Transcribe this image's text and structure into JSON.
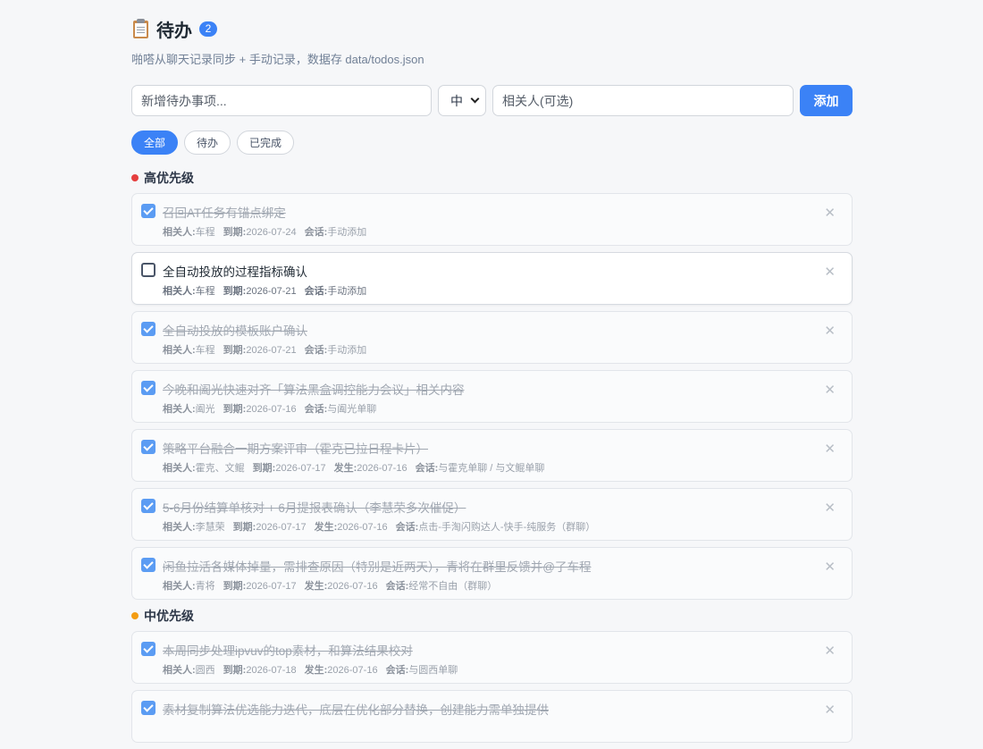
{
  "header": {
    "title": "待办",
    "count": "2",
    "subtitle": "啪嗒从聊天记录同步 + 手动记录，数据存 data/todos.json"
  },
  "add_form": {
    "task_placeholder": "新增待办事项...",
    "priority_value": "中",
    "person_placeholder": "相关人(可选)",
    "add_label": "添加"
  },
  "filters": [
    {
      "label": "全部",
      "active": true
    },
    {
      "label": "待办",
      "active": false
    },
    {
      "label": "已完成",
      "active": false
    }
  ],
  "sections": [
    {
      "title": "高优先级",
      "color": "#e53e3e",
      "items": [
        {
          "done": true,
          "title": "召回AT任务有锚点绑定",
          "meta": [
            [
              "相关人:",
              "车程"
            ],
            [
              "到期:",
              "2026-07-24"
            ],
            [
              "会话:",
              "手动添加"
            ]
          ]
        },
        {
          "done": false,
          "title": "全自动投放的过程指标确认",
          "meta": [
            [
              "相关人:",
              "车程"
            ],
            [
              "到期:",
              "2026-07-21"
            ],
            [
              "会话:",
              "手动添加"
            ]
          ]
        },
        {
          "done": true,
          "title": "全自动投放的模板账户确认",
          "meta": [
            [
              "相关人:",
              "车程"
            ],
            [
              "到期:",
              "2026-07-21"
            ],
            [
              "会话:",
              "手动添加"
            ]
          ]
        },
        {
          "done": true,
          "title": "今晚和阖光快速对齐「算法黑盒调控能力会议」相关内容",
          "meta": [
            [
              "相关人:",
              "阖光"
            ],
            [
              "到期:",
              "2026-07-16"
            ],
            [
              "会话:",
              "与阖光单聊"
            ]
          ]
        },
        {
          "done": true,
          "title": "策略平台融合一期方案评审（霍克已拉日程卡片）",
          "meta": [
            [
              "相关人:",
              "霍克、文鲲"
            ],
            [
              "到期:",
              "2026-07-17"
            ],
            [
              "发生:",
              "2026-07-16"
            ],
            [
              "会话:",
              "与霍克单聊 / 与文鲲单聊"
            ]
          ]
        },
        {
          "done": true,
          "title": "5-6月份结算单核对 + 6月提报表确认（李慧荣多次催促）",
          "meta": [
            [
              "相关人:",
              "李慧荣"
            ],
            [
              "到期:",
              "2026-07-17"
            ],
            [
              "发生:",
              "2026-07-16"
            ],
            [
              "会话:",
              "点击-手淘闪购达人-快手-纯服务（群聊）"
            ]
          ]
        },
        {
          "done": true,
          "title": "闲鱼拉活各媒体掉量，需排查原因（特别是近两天），青将在群里反馈并@了车程",
          "meta": [
            [
              "相关人:",
              "青将"
            ],
            [
              "到期:",
              "2026-07-17"
            ],
            [
              "发生:",
              "2026-07-16"
            ],
            [
              "会话:",
              "经常不自由（群聊）"
            ]
          ]
        }
      ]
    },
    {
      "title": "中优先级",
      "color": "#f39c12",
      "items": [
        {
          "done": true,
          "title": "本周同步处理ipvuv的top素材，和算法结果校对",
          "meta": [
            [
              "相关人:",
              "圆西"
            ],
            [
              "到期:",
              "2026-07-18"
            ],
            [
              "发生:",
              "2026-07-16"
            ],
            [
              "会话:",
              "与圆西单聊"
            ]
          ]
        },
        {
          "done": true,
          "title": "素材复制算法优选能力迭代，底层在优化部分替换，创建能力需单独提供",
          "meta": []
        }
      ]
    }
  ],
  "icons": {
    "clipboard": "clipboard-icon",
    "close": "close-icon",
    "checkbox": "checkbox-icon",
    "chevron": "chevron-down-icon"
  }
}
